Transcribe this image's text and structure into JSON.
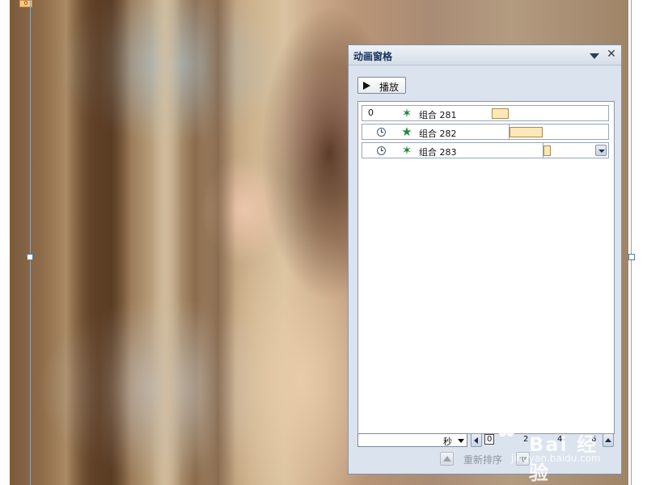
{
  "slide": {
    "corner_tag": "0"
  },
  "pane": {
    "title": "动画窗格",
    "play_label": "播放",
    "items": [
      {
        "index": "0",
        "name": "组合  281",
        "timing": "on-click",
        "icon": "motion-star-icon"
      },
      {
        "index": "",
        "name": "组合  282",
        "timing": "after-previous",
        "icon": "spin-star-icon"
      },
      {
        "index": "",
        "name": "组合  283",
        "timing": "after-previous",
        "icon": "motion-star-icon"
      }
    ],
    "timeline": {
      "unit": "秒",
      "ticks": [
        "0",
        "2",
        "4",
        "6"
      ]
    },
    "reorder_label": "重新排序"
  },
  "watermark": {
    "text": "Bai 经验",
    "url": "jingyan.baidu.com"
  },
  "colors": {
    "pane_bg": "#dbe3ee",
    "timebar_fill": "#fde8b6",
    "effect_icon": "#1f8a3b"
  }
}
